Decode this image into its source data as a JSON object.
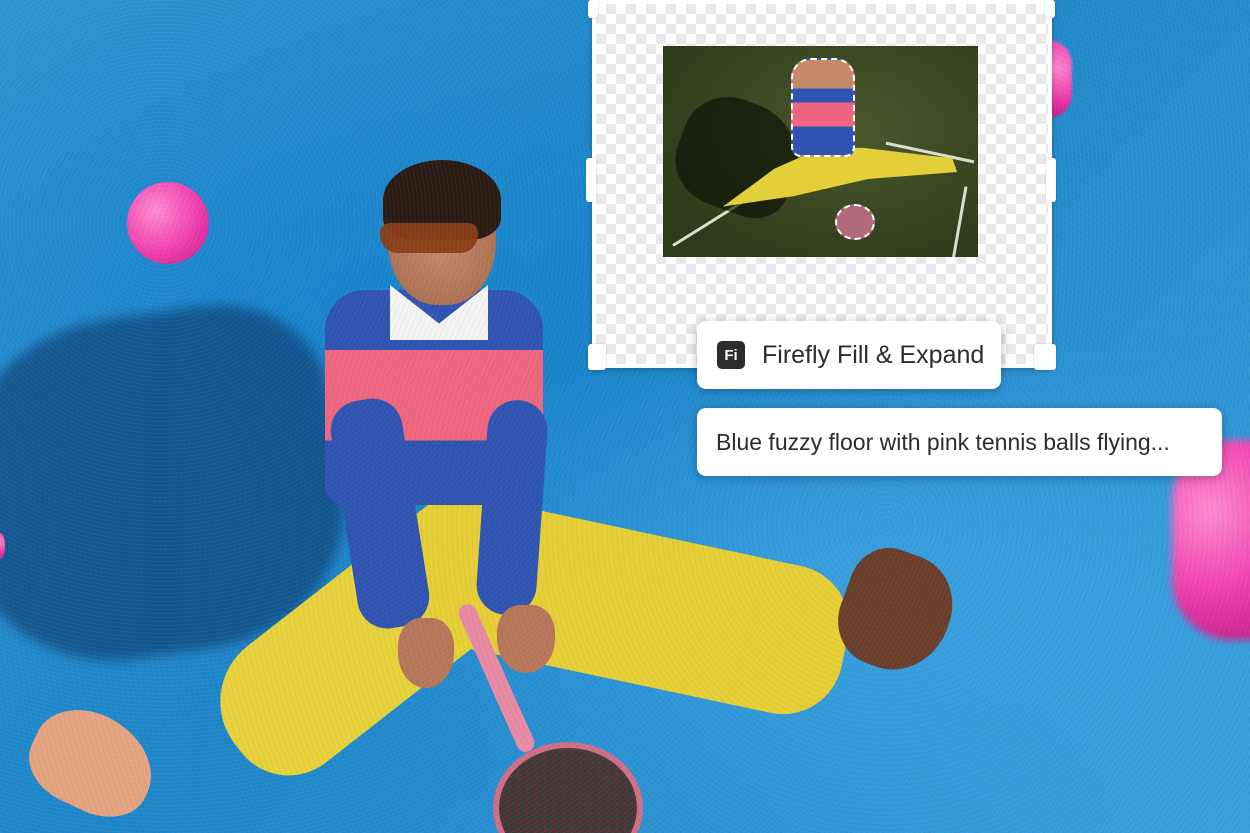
{
  "generative_fill": {
    "badge_text": "Fi",
    "button_label": "Firefly Fill & Expand",
    "prompt_text": "Blue fuzzy floor with pink tennis balls flying..."
  },
  "canvas": {
    "background": "transparency-checkerboard",
    "preview": "subject-selection-with-marching-ants"
  },
  "colors": {
    "floor": "#1d86c9",
    "ball": "#f03fae",
    "sweater_blue": "#2f54b2",
    "sweater_pink": "#ef6680",
    "pants": "#e6cf36"
  }
}
